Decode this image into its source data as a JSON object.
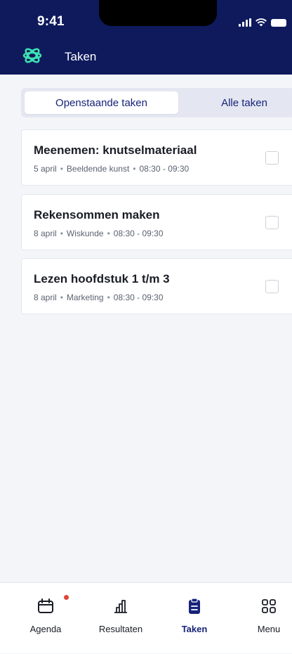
{
  "status_bar": {
    "time": "9:41"
  },
  "header": {
    "title": "Taken",
    "logo_icon": "atom-logo-icon",
    "background_color": "#0e1a5c"
  },
  "tabs": {
    "open_label": "Openstaande taken",
    "all_label": "Alle taken",
    "active": "Openstaande taken"
  },
  "tasks": [
    {
      "title": "Meenemen: knutselmateriaal",
      "date": "5 april",
      "subject": "Beeldende kunst",
      "time": "08:30 - 09:30",
      "done": false
    },
    {
      "title": "Rekensommen maken",
      "date": "8 april",
      "subject": "Wiskunde",
      "time": "08:30 - 09:30",
      "done": false
    },
    {
      "title": "Lezen hoofdstuk 1 t/m 3",
      "date": "8 april",
      "subject": "Marketing",
      "time": "08:30 - 09:30",
      "done": false
    }
  ],
  "bottom_nav": {
    "items": [
      {
        "label": "Agenda",
        "icon": "calendar-icon",
        "has_notification": true
      },
      {
        "label": "Resultaten",
        "icon": "bar-chart-icon"
      },
      {
        "label": "Taken",
        "icon": "clipboard-icon",
        "active": true
      },
      {
        "label": "Menu",
        "icon": "grid-icon"
      }
    ]
  },
  "colors": {
    "accent": "#17237a",
    "notification": "#e0453a",
    "page_background": "#f4f5f8"
  }
}
